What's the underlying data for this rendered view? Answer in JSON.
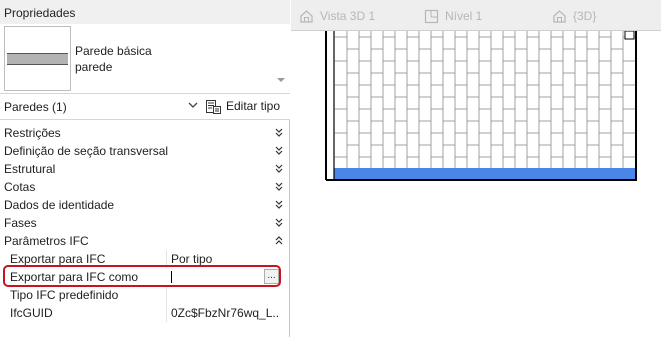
{
  "properties": {
    "title": "Propriedades",
    "type_selector": {
      "line1": "Parede básica",
      "line2": "parede"
    },
    "instance": {
      "label": "Paredes (1)",
      "edit_type_label": "Editar tipo"
    },
    "sections": [
      {
        "label": "Restrições",
        "state": "collapsed"
      },
      {
        "label": "Definição de seção transversal",
        "state": "collapsed"
      },
      {
        "label": "Estrutural",
        "state": "collapsed"
      },
      {
        "label": "Cotas",
        "state": "collapsed"
      },
      {
        "label": "Dados de identidade",
        "state": "collapsed"
      },
      {
        "label": "Fases",
        "state": "collapsed"
      },
      {
        "label": "Parâmetros IFC",
        "state": "expanded"
      }
    ],
    "ifc_rows": [
      {
        "key": "Exportar para IFC",
        "value": "Por tipo"
      },
      {
        "key": "Exportar para IFC como",
        "value": "",
        "editing": true,
        "browse_label": "..."
      },
      {
        "key": "Tipo IFC predefinido",
        "value": ""
      },
      {
        "key": "IfcGUID",
        "value": "0Zc$FbzNr76wq_L..."
      }
    ]
  },
  "view_tabs": [
    {
      "label": "Vista 3D 1",
      "icon": "3d-view-icon"
    },
    {
      "label": "Nível 1",
      "icon": "floor-plan-icon"
    },
    {
      "label": "{3D}",
      "icon": "3d-view-icon"
    }
  ],
  "colors": {
    "highlight": "#c8141e",
    "wall_base": "#4a86e8",
    "tab_text": "#b6b6b6"
  }
}
